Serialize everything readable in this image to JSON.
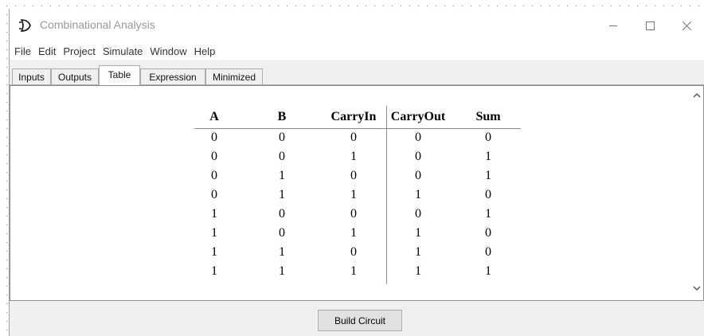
{
  "window": {
    "title": "Combinational Analysis"
  },
  "menu": [
    "File",
    "Edit",
    "Project",
    "Simulate",
    "Window",
    "Help"
  ],
  "tabs": [
    "Inputs",
    "Outputs",
    "Table",
    "Expression",
    "Minimized"
  ],
  "active_tab": "Table",
  "table": {
    "input_headers": [
      "A",
      "B",
      "CarryIn"
    ],
    "output_headers": [
      "CarryOut",
      "Sum"
    ],
    "rows": [
      [
        "0",
        "0",
        "0",
        "0",
        "0"
      ],
      [
        "0",
        "0",
        "1",
        "0",
        "1"
      ],
      [
        "0",
        "1",
        "0",
        "0",
        "1"
      ],
      [
        "0",
        "1",
        "1",
        "1",
        "0"
      ],
      [
        "1",
        "0",
        "0",
        "0",
        "1"
      ],
      [
        "1",
        "0",
        "1",
        "1",
        "0"
      ],
      [
        "1",
        "1",
        "0",
        "1",
        "0"
      ],
      [
        "1",
        "1",
        "1",
        "1",
        "1"
      ]
    ]
  },
  "build_button": "Build Circuit",
  "icons": {
    "app": "logic-gate-icon",
    "minimize": "minimize-icon",
    "maximize": "maximize-icon",
    "close": "close-icon",
    "scroll_up": "chevron-up-icon",
    "scroll_down": "chevron-down-icon"
  }
}
